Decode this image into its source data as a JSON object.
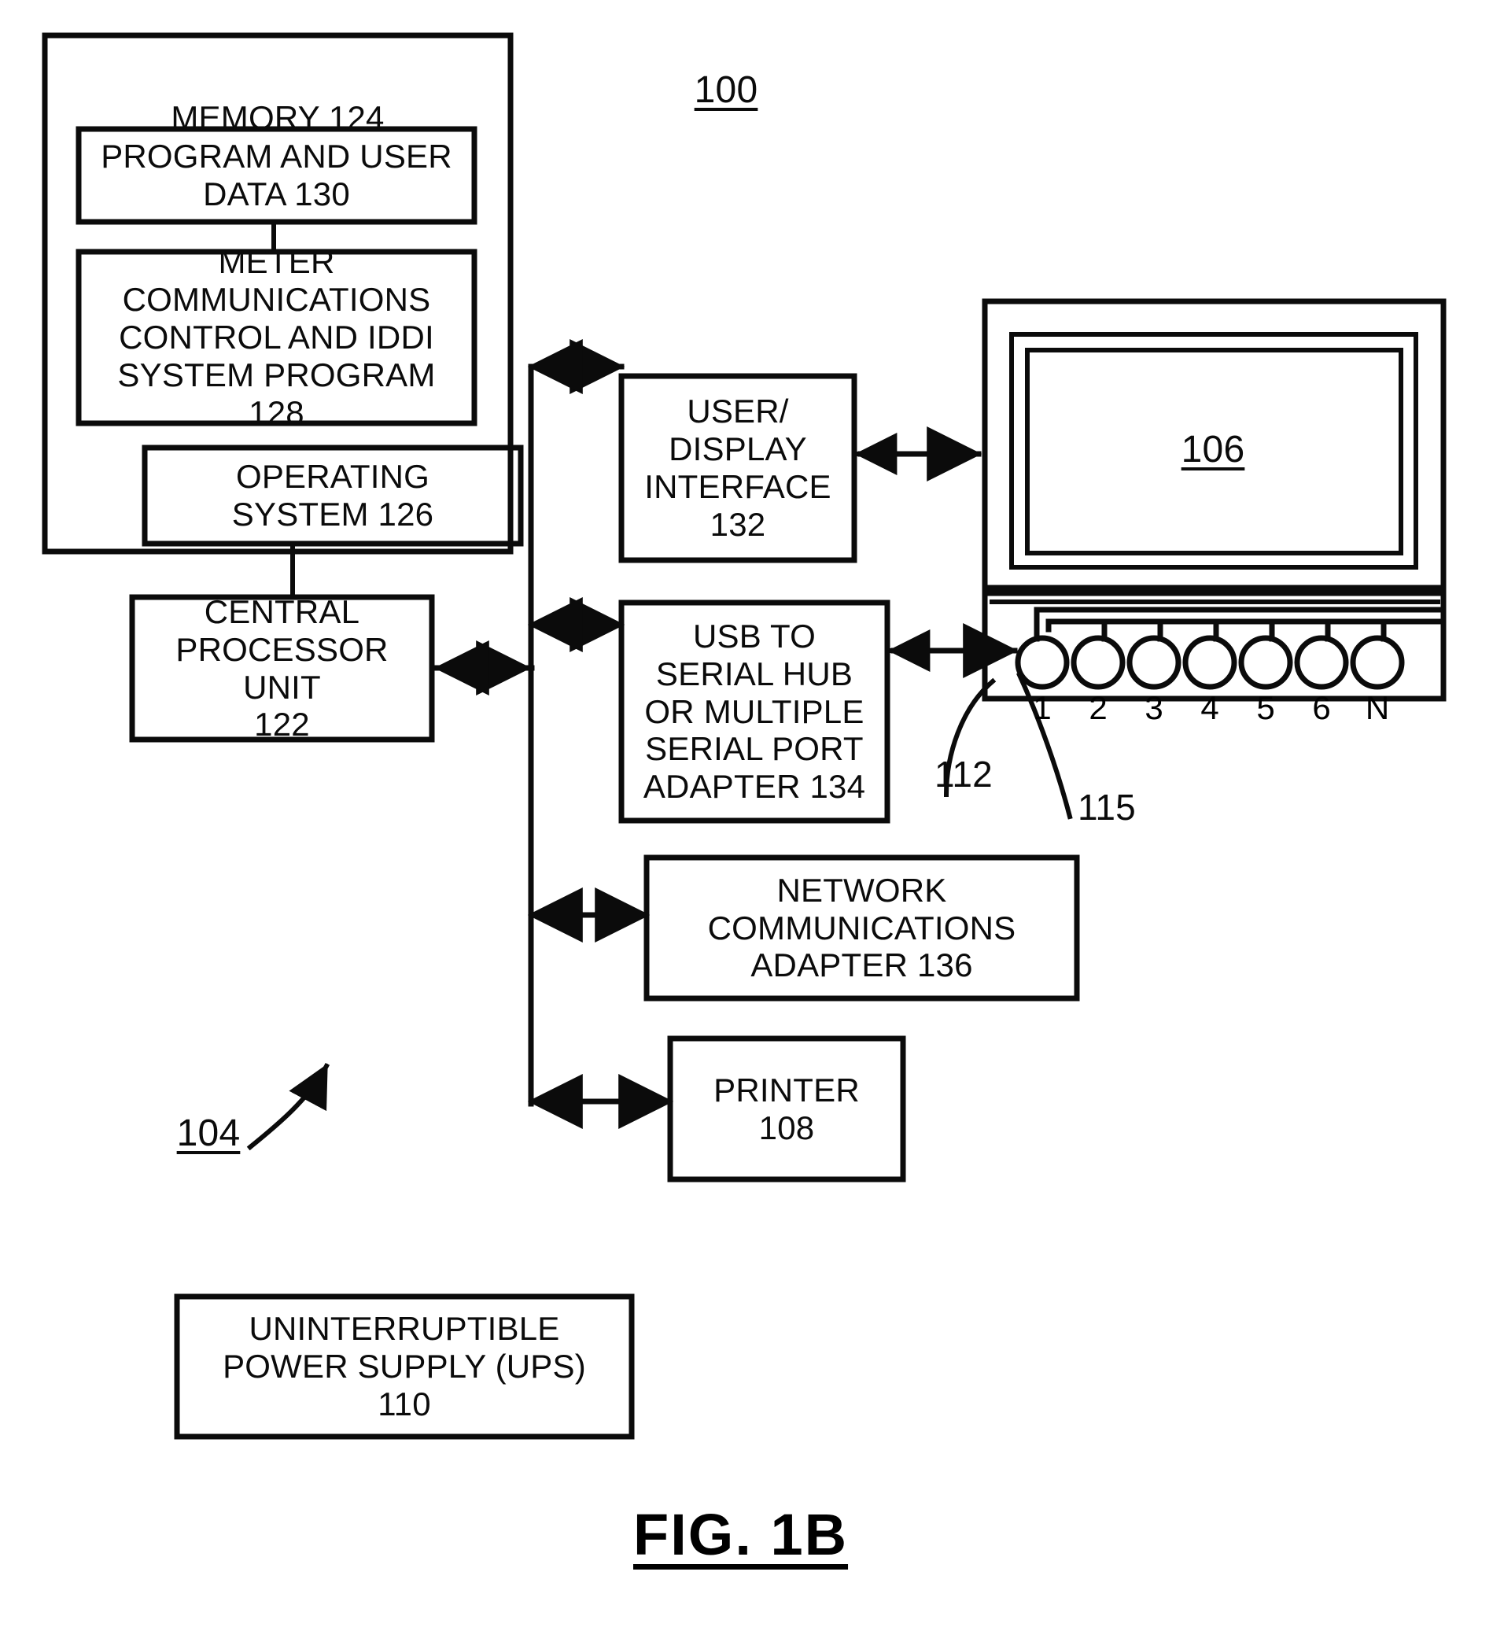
{
  "figure": {
    "caption": "FIG. 1B",
    "system_ref": "100",
    "computer_ref": "104",
    "monitor_ref": "106",
    "port_connector_ref": "112",
    "port_arrow_ref": "115"
  },
  "blocks": {
    "memory": {
      "label": "MEMORY 124"
    },
    "program_data": {
      "label": "PROGRAM AND USER\nDATA 130"
    },
    "meter_program": {
      "label": "METER\nCOMMUNICATIONS\nCONTROL AND IDDI\nSYSTEM PROGRAM\n128"
    },
    "operating_system": {
      "label": "OPERATING\nSYSTEM 126"
    },
    "cpu": {
      "label": "CENTRAL\nPROCESSOR\nUNIT\n122"
    },
    "user_display_interface": {
      "label": "USER/\nDISPLAY\nINTERFACE\n132"
    },
    "usb_hub": {
      "label": "USB TO\nSERIAL HUB\nOR MULTIPLE\nSERIAL PORT\nADAPTER 134"
    },
    "network_adapter": {
      "label": "NETWORK\nCOMMUNICATIONS\nADAPTER 136"
    },
    "printer": {
      "label": "PRINTER\n108"
    },
    "ups": {
      "label": "UNINTERRUPTIBLE\nPOWER SUPPLY (UPS)\n110"
    }
  },
  "ports": {
    "labels": [
      "1",
      "2",
      "3",
      "4",
      "5",
      "6",
      "N"
    ]
  },
  "colors": {
    "ink": "#0b0b0b",
    "paper": "#ffffff"
  }
}
